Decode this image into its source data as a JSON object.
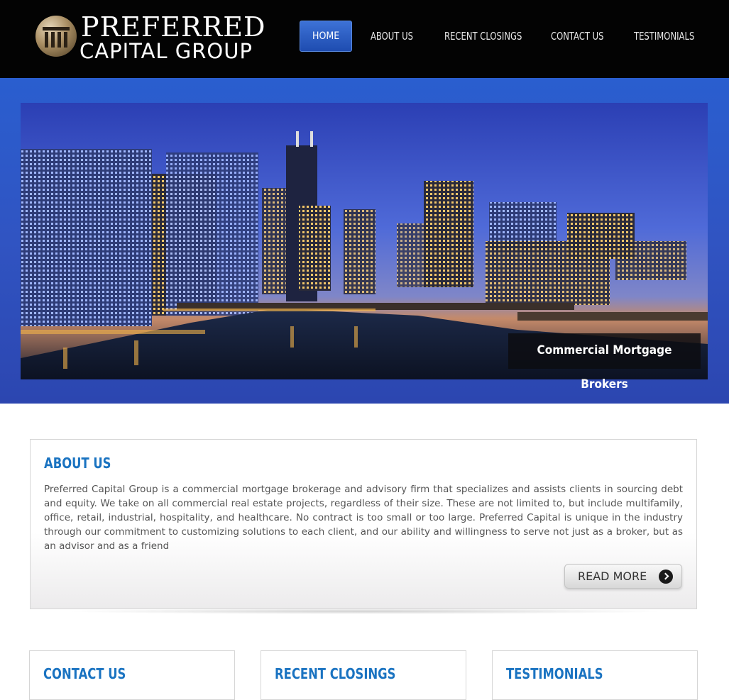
{
  "brand": {
    "line1": "PREFERRED",
    "line2": "CAPITAL GROUP"
  },
  "nav": {
    "items": [
      {
        "label": "HOME",
        "active": true
      },
      {
        "label": "ABOUT US",
        "active": false
      },
      {
        "label": "RECENT CLOSINGS",
        "active": false
      },
      {
        "label": "CONTACT US",
        "active": false
      },
      {
        "label": "TESTIMONIALS",
        "active": false
      }
    ]
  },
  "hero": {
    "caption": "Commercial Mortgage Brokers"
  },
  "about": {
    "title": "ABOUT US",
    "text": "Preferred Capital Group is a commercial mortgage brokerage and advisory firm that specializes and assists clients in sourcing debt and equity. We take on all commercial real estate projects, regardless of their size. These are not limited to, but include multifamily, office, retail, industrial, hospitality, and healthcare. No contract is too small or too large. Preferred Capital is unique in the industry through our commitment to customizing solutions to each client, and our ability and willingness to serve not just as a broker, but as an advisor and as a friend",
    "read_more": "READ MORE"
  },
  "cards": [
    {
      "title": "CONTACT US"
    },
    {
      "title": "RECENT CLOSINGS"
    },
    {
      "title": "TESTIMONIALS"
    }
  ],
  "colors": {
    "header_bg": "#030303",
    "accent_blue": "#2a5ecf",
    "title_blue": "#1a73c1"
  }
}
